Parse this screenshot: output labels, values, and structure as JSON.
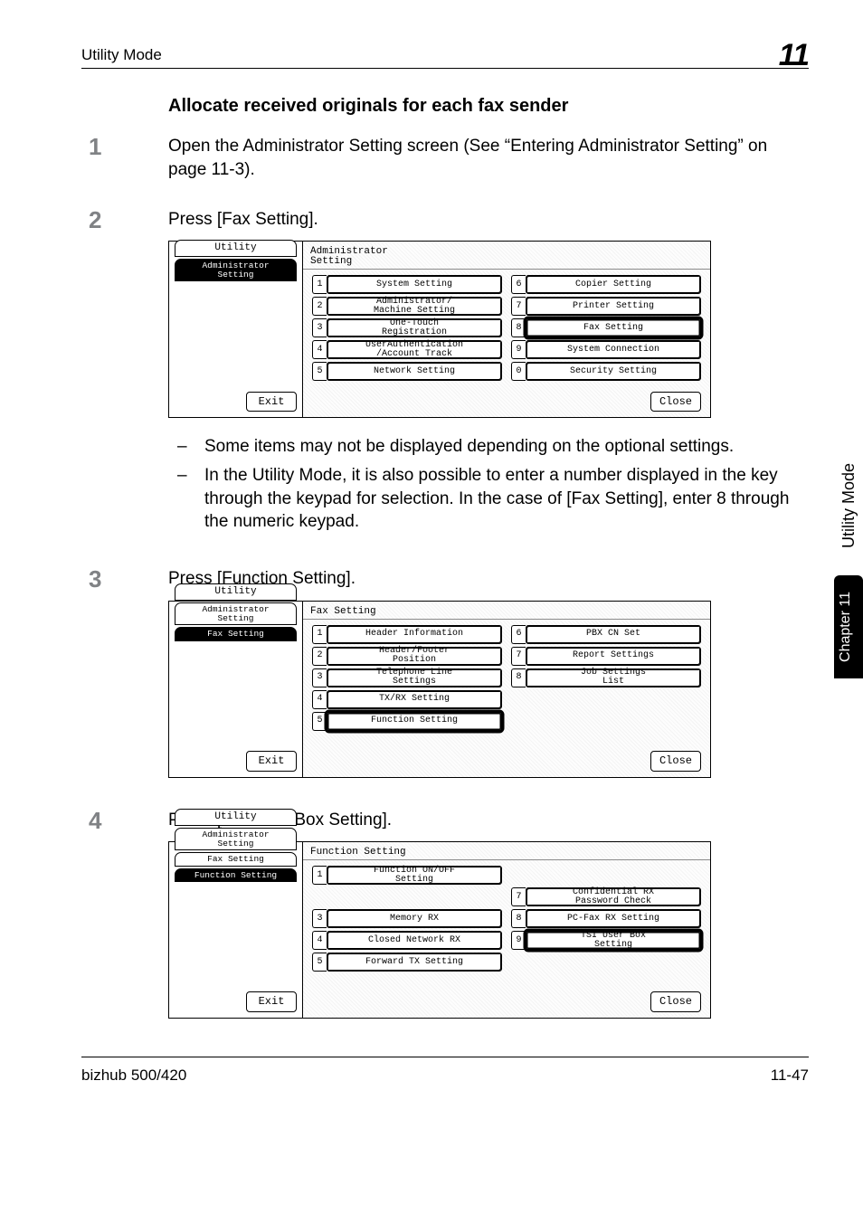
{
  "running_head": {
    "left": "Utility Mode",
    "right": "11"
  },
  "section_title": "Allocate received originals for each fax sender",
  "steps": [
    {
      "n": "1",
      "text": "Open the Administrator Setting screen (See “Entering Administrator Setting” on page 11-3)."
    },
    {
      "n": "2",
      "text": "Press [Fax Setting]."
    },
    {
      "n": "3",
      "text": "Press [Function Setting]."
    },
    {
      "n": "4",
      "text": "Press [TSI User Box Setting]."
    }
  ],
  "notes_after_step2": [
    "Some items may not be displayed depending on the optional settings.",
    "In the Utility Mode, it is also possible to enter a number displayed in the key through the keypad for selection. In the case of [Fax Setting], enter 8 through the numeric keypad."
  ],
  "lcd1": {
    "title": "Administrator\nSetting",
    "left_tabs": [
      {
        "label": "Utility",
        "active": false,
        "top": true
      },
      {
        "label": "Administrator\nSetting",
        "active": true,
        "top": false
      }
    ],
    "left_btns": [
      "System Setting",
      "Administrator/\nMachine Setting",
      "One-Touch\nRegistration",
      "UserAuthentication\n/Account Track",
      "Network Setting"
    ],
    "right_btns": [
      "Copier Setting",
      "Printer Setting",
      "Fax Setting",
      "System Connection",
      "Security Setting"
    ],
    "right_nums": [
      "6",
      "7",
      "8",
      "9",
      "0"
    ],
    "highlight_right_index": 2,
    "exit": "Exit",
    "close": "Close"
  },
  "lcd2": {
    "title": "Fax Setting",
    "left_tabs": [
      {
        "label": "Utility",
        "active": false,
        "top": true
      },
      {
        "label": "Administrator\nSetting",
        "active": false,
        "top": false
      },
      {
        "label": "Fax Setting",
        "active": true,
        "top": false
      }
    ],
    "left_btns": [
      "Header Information",
      "Header/Footer\nPosition",
      "Telephone Line\nSettings",
      "TX/RX Setting",
      "Function Setting"
    ],
    "right_btns": [
      "PBX CN Set",
      "Report Settings",
      "Job Settings\nList",
      "",
      ""
    ],
    "right_nums": [
      "6",
      "7",
      "8",
      "",
      ""
    ],
    "highlight_left_index": 4,
    "exit": "Exit",
    "close": "Close"
  },
  "lcd3": {
    "title": "Function Setting",
    "left_tabs": [
      {
        "label": "Utility",
        "active": false,
        "top": true
      },
      {
        "label": "Administrator\nSetting",
        "active": false,
        "top": false
      },
      {
        "label": "Fax Setting",
        "active": false,
        "top": false
      },
      {
        "label": "Function Setting",
        "active": true,
        "top": false
      }
    ],
    "left_btns": [
      "Function ON/OFF\nSetting",
      "",
      "Memory RX",
      "Closed Network RX",
      "Forward TX Setting"
    ],
    "left_nums": [
      "1",
      "",
      "3",
      "4",
      "5"
    ],
    "right_btns": [
      "",
      "Confidential RX\nPassword Check",
      "PC-Fax RX Setting",
      "TSI User Box\nSetting",
      ""
    ],
    "right_nums": [
      "",
      "7",
      "8",
      "9",
      ""
    ],
    "highlight_right_index": 3,
    "exit": "Exit",
    "close": "Close"
  },
  "side": {
    "dark": "Chapter 11",
    "light": "Utility Mode"
  },
  "footer": {
    "left": "bizhub 500/420",
    "right": "11-47"
  }
}
